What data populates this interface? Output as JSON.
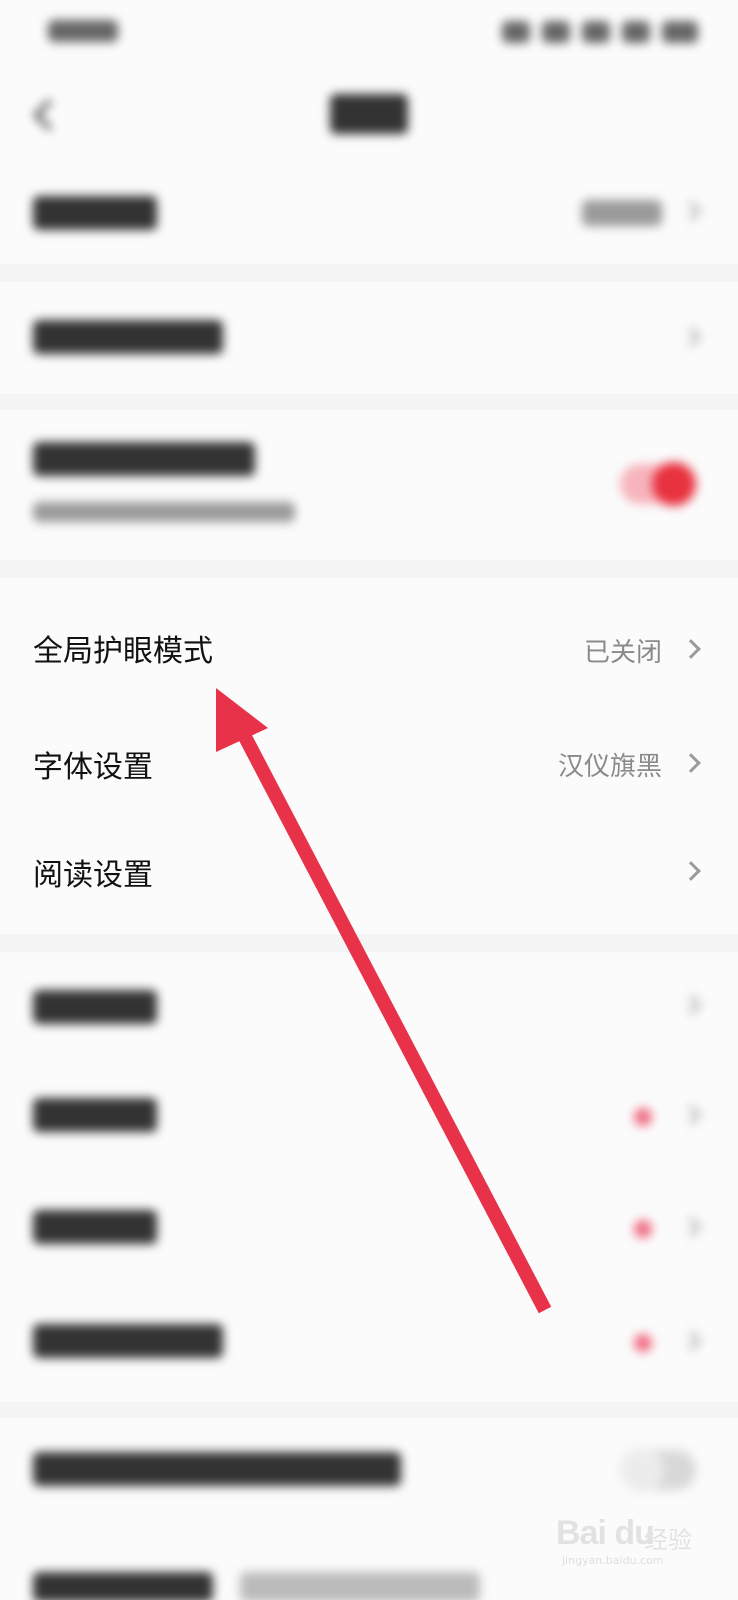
{
  "settings_list": {
    "eye_protection": {
      "label": "全局护眼模式",
      "value": "已关闭"
    },
    "font": {
      "label": "字体设置",
      "value": "汉仪旗黑"
    },
    "reading": {
      "label": "阅读设置"
    }
  },
  "watermark": {
    "brand": "Bai du",
    "brand_cn": "经验",
    "site": "jingyan.baidu.com"
  },
  "colors": {
    "accent_red": "#e8323f",
    "annotation_arrow": "#e8324a",
    "background": "#f4f4f4",
    "card": "#fbfbfb"
  },
  "icons": {
    "back": "chevron-left-icon",
    "chevron": "chevron-right-icon"
  }
}
